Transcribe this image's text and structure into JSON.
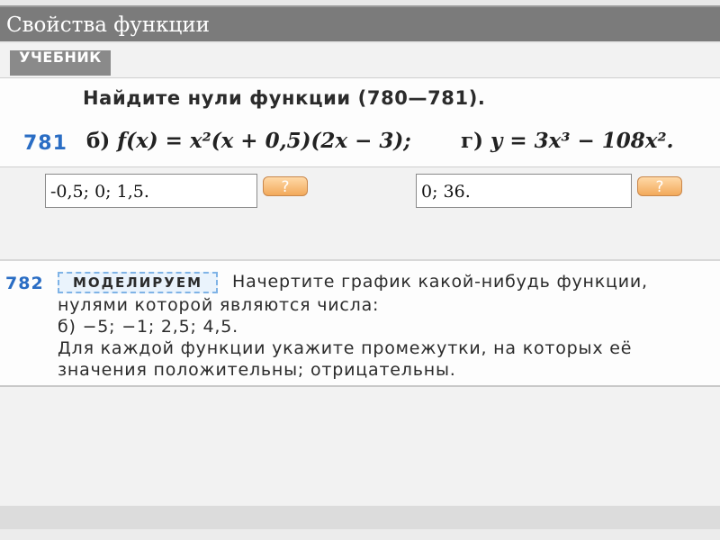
{
  "slide": {
    "title": "Свойства функции",
    "badge": "УЧЕБНИК"
  },
  "task781": {
    "heading": "Найдите нули функции (780—781).",
    "number": "781",
    "part_b_label": "б)",
    "part_b_formula": "f(x) = x²(x + 0,5)(2x − 3);",
    "part_g_label": "г)",
    "part_g_formula": "y = 3x³ − 108x².",
    "answer_b": "-0,5; 0; 1,5.",
    "answer_g": "0; 36.",
    "hint_label": "?"
  },
  "task782": {
    "number": "782",
    "tag": "МОДЕЛИРУЕМ",
    "line1": "Начертите график какой-нибудь функции,",
    "line2": "нулями которой являются числа:",
    "line3": "б) −5; −1; 2,5; 4,5.",
    "line4": "Для каждой функции укажите промежутки, на которых её",
    "line5": "значения положительны; отрицательны."
  },
  "colors": {
    "accent_blue": "#2a6dc4",
    "hint_orange": "#f2a95a",
    "title_bar": "#7b7b7b"
  }
}
